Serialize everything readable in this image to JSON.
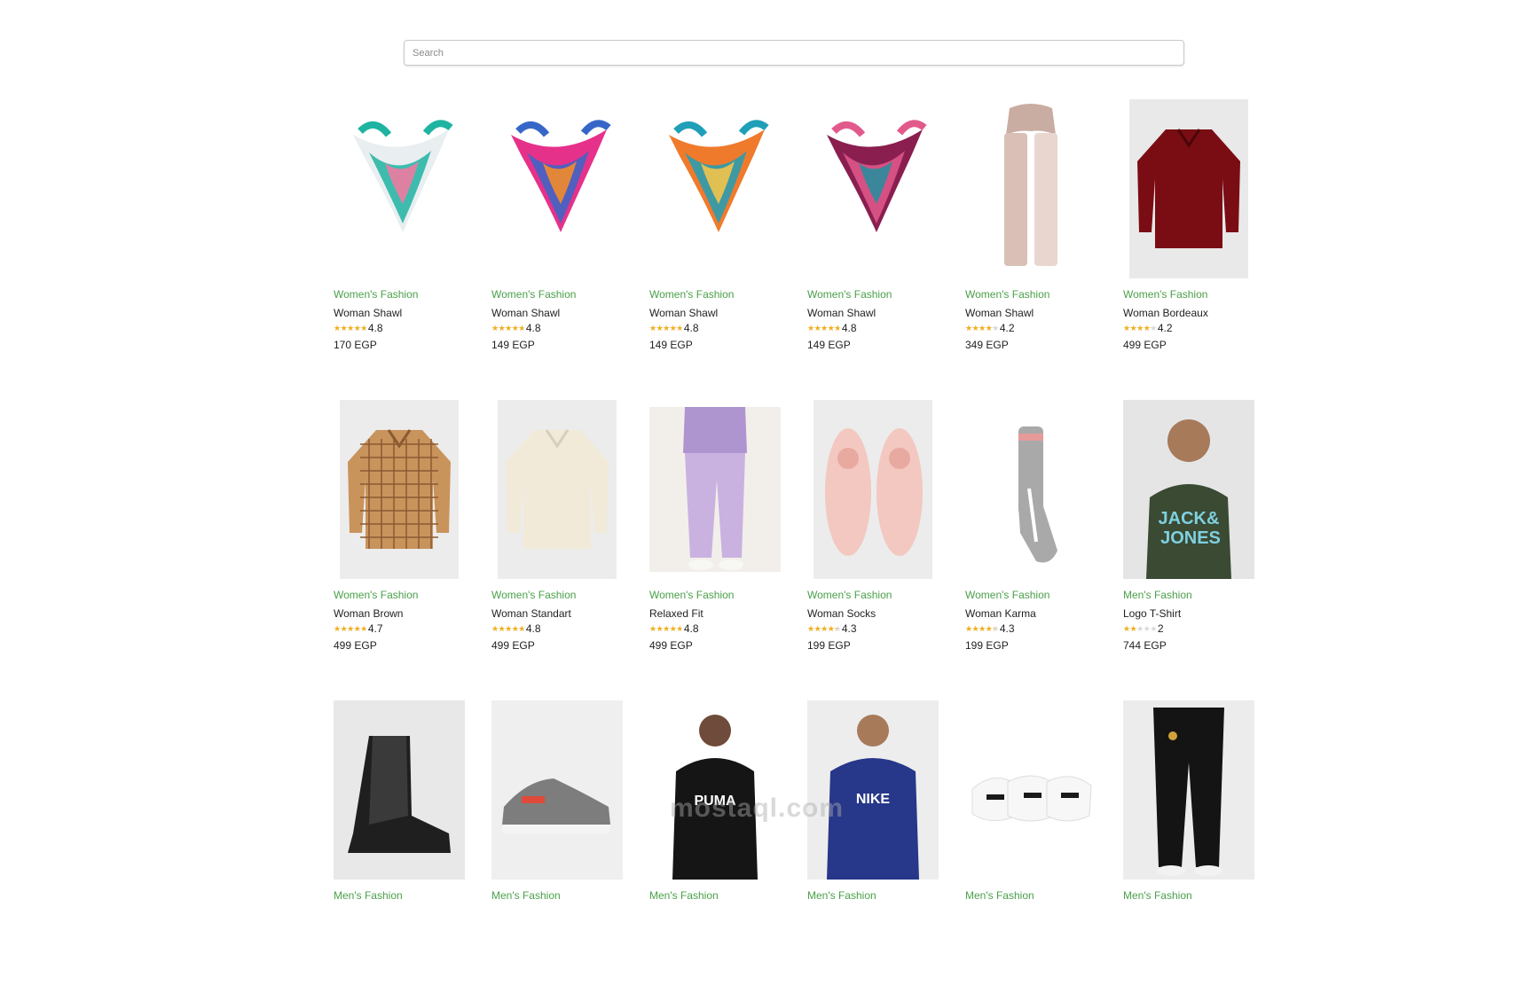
{
  "search": {
    "placeholder": "Search",
    "value": ""
  },
  "products": [
    {
      "category": "Women's Fashion",
      "title": "Woman Shawl",
      "rating": 4.8,
      "rating_text": "4.8",
      "price": "170 EGP",
      "image": "scarf-white-teal-icon",
      "colors": [
        "#e9eef0",
        "#1fb3a2",
        "#ee7aa1"
      ]
    },
    {
      "category": "Women's Fashion",
      "title": "Woman Shawl",
      "rating": 4.8,
      "rating_text": "4.8",
      "price": "149 EGP",
      "image": "scarf-pink-blue-icon",
      "colors": [
        "#e6318a",
        "#3667c8",
        "#f28c2b"
      ]
    },
    {
      "category": "Women's Fashion",
      "title": "Woman Shawl",
      "rating": 4.8,
      "rating_text": "4.8",
      "price": "149 EGP",
      "image": "scarf-orange-teal-icon",
      "colors": [
        "#f07a2c",
        "#1f9fb8",
        "#f3c44a"
      ]
    },
    {
      "category": "Women's Fashion",
      "title": "Woman Shawl",
      "rating": 4.8,
      "rating_text": "4.8",
      "price": "149 EGP",
      "image": "scarf-plum-icon",
      "colors": [
        "#8a1f4f",
        "#e25a8c",
        "#2a8c9c"
      ]
    },
    {
      "category": "Women's Fashion",
      "title": "Woman Shawl",
      "rating": 4.2,
      "rating_text": "4.2",
      "price": "349 EGP",
      "image": "scarf-beige-icon",
      "colors": [
        "#d9bfb5",
        "#c9aca2",
        "#e8d6cf"
      ]
    },
    {
      "category": "Women's Fashion",
      "title": "Woman Bordeaux",
      "rating": 4.2,
      "rating_text": "4.2",
      "price": "499 EGP",
      "image": "shirt-bordeaux-icon",
      "colors": [
        "#7a0d14",
        "#e9e9e9",
        "#5e0a10"
      ]
    },
    {
      "category": "Women's Fashion",
      "title": "Woman Brown",
      "rating": 4.7,
      "rating_text": "4.7",
      "price": "499 EGP",
      "image": "shirt-plaid-icon",
      "colors": [
        "#c9935c",
        "#8a5a32",
        "#ececec"
      ]
    },
    {
      "category": "Women's Fashion",
      "title": "Woman Standart",
      "rating": 4.8,
      "rating_text": "4.8",
      "price": "499 EGP",
      "image": "hoodie-cream-icon",
      "colors": [
        "#f1ead9",
        "#d8cfba",
        "#ececec"
      ]
    },
    {
      "category": "Women's Fashion",
      "title": "Relaxed Fit",
      "rating": 4.8,
      "rating_text": "4.8",
      "price": "499 EGP",
      "image": "joggers-lilac-icon",
      "colors": [
        "#c9b2e0",
        "#ae95cf",
        "#f2efeb"
      ]
    },
    {
      "category": "Women's Fashion",
      "title": "Woman Socks",
      "rating": 4.3,
      "rating_text": "4.3",
      "price": "199 EGP",
      "image": "slippers-pink-icon",
      "colors": [
        "#f3c8c0",
        "#e8a9a0",
        "#ececec"
      ]
    },
    {
      "category": "Women's Fashion",
      "title": "Woman Karma",
      "rating": 4.3,
      "rating_text": "4.3",
      "price": "199 EGP",
      "image": "sock-grey-icon",
      "colors": [
        "#a9a9a9",
        "#e79a9a",
        "#ffffff"
      ]
    },
    {
      "category": "Men's Fashion",
      "title": "Logo T-Shirt",
      "rating": 2,
      "rating_text": "2",
      "price": "744 EGP",
      "image": "tshirt-green-icon",
      "colors": [
        "#3a4a33",
        "#7fd0e0",
        "#e5e5e5"
      ]
    },
    {
      "category": "Men's Fashion",
      "title": "",
      "rating": 0,
      "rating_text": "",
      "price": "",
      "image": "boot-black-icon",
      "colors": [
        "#1f1f1f",
        "#3a3a3a",
        "#e8e8e8"
      ]
    },
    {
      "category": "Men's Fashion",
      "title": "",
      "rating": 0,
      "rating_text": "",
      "price": "",
      "image": "sneaker-grey-icon",
      "colors": [
        "#7d7d7d",
        "#e04a3a",
        "#efefef"
      ]
    },
    {
      "category": "Men's Fashion",
      "title": "",
      "rating": 0,
      "rating_text": "",
      "price": "",
      "image": "hoodie-black-icon",
      "colors": [
        "#151515",
        "#ffffff",
        "#ffffff"
      ]
    },
    {
      "category": "Men's Fashion",
      "title": "",
      "rating": 0,
      "rating_text": "",
      "price": "",
      "image": "hoodie-navy-icon",
      "colors": [
        "#27378a",
        "#ffffff",
        "#ededed"
      ]
    },
    {
      "category": "Men's Fashion",
      "title": "",
      "rating": 0,
      "rating_text": "",
      "price": "",
      "image": "socks-white-icon",
      "colors": [
        "#f7f7f7",
        "#1a1a1a",
        "#ffffff"
      ]
    },
    {
      "category": "Men's Fashion",
      "title": "",
      "rating": 0,
      "rating_text": "",
      "price": "",
      "image": "trackpants-black-icon",
      "colors": [
        "#141414",
        "#d2a23a",
        "#ececec"
      ]
    }
  ],
  "watermark": "mostaql.com"
}
